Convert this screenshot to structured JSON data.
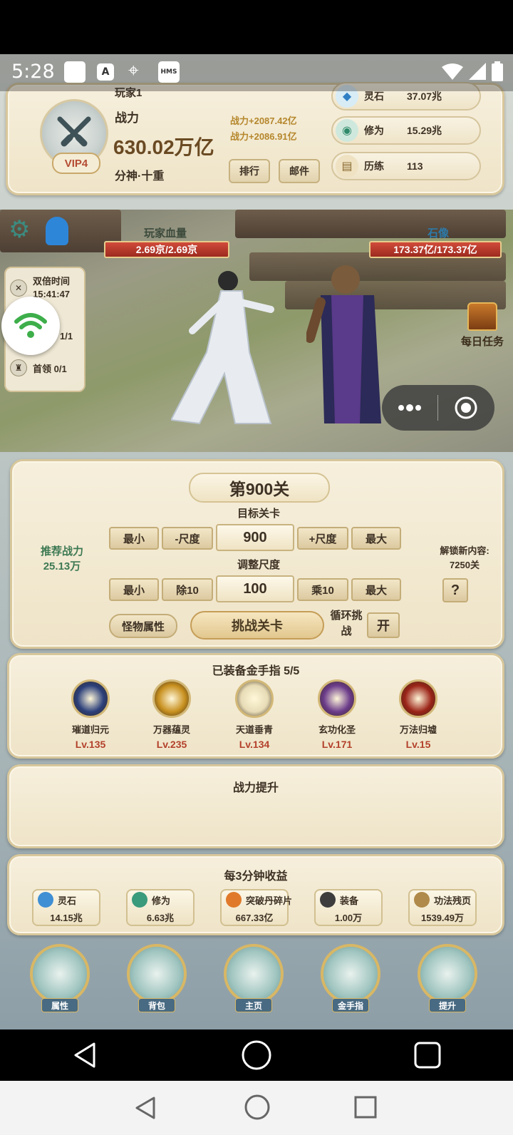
{
  "status_bar": {
    "time": "5:28",
    "hms_label": "HMS",
    "a_label": "A"
  },
  "player": {
    "name": "玩家1",
    "power_label": "战力",
    "power_value": "630.02万亿",
    "vip": "VIP4",
    "realm": "分神·十重",
    "power_gain_1": "战力+2087.42亿",
    "power_gain_2": "战力+2086.91亿",
    "rank_button": "排行",
    "mail_button": "邮件"
  },
  "resources": [
    {
      "name": "灵石",
      "value": "37.07兆",
      "icon": "spirit-stone-icon"
    },
    {
      "name": "修为",
      "value": "15.29兆",
      "icon": "cultivation-icon"
    },
    {
      "name": "历练",
      "value": "113",
      "icon": "scroll-icon"
    }
  ],
  "battle": {
    "player_hp_label": "玩家血量",
    "player_hp": "2.69京/2.69京",
    "enemy_name": "石像",
    "enemy_hp": "173.37亿/173.37亿",
    "double_time_label": "双倍时间",
    "double_time_value": "15:41:47",
    "counter_value": "1/1",
    "boss_label": "首领 0/1",
    "daily_task": "每日任务"
  },
  "stage": {
    "title": "第900关",
    "target_label": "目标关卡",
    "recommend_label": "推荐战力",
    "recommend_value": "25.13万",
    "unlock_label": "解锁新内容:",
    "unlock_value": "7250关",
    "help": "?",
    "row1": {
      "min": "最小",
      "minus": "-尺度",
      "value": "900",
      "plus": "+尺度",
      "max": "最大"
    },
    "scale_label": "调整尺度",
    "row2": {
      "min": "最小",
      "div": "除10",
      "value": "100",
      "mul": "乘10",
      "max": "最大"
    },
    "monster_attr": "怪物属性",
    "challenge": "挑战关卡",
    "loop_label": "循环挑战",
    "loop_toggle": "开"
  },
  "golden_finger": {
    "title": "已装备金手指 5/5",
    "items": [
      {
        "name": "璀道归元",
        "level": "Lv.135",
        "color": "#2b3f7a"
      },
      {
        "name": "万器蕴灵",
        "level": "Lv.235",
        "color": "#c8901f"
      },
      {
        "name": "天道垂青",
        "level": "Lv.134",
        "color": "#e7dcb6"
      },
      {
        "name": "玄功化圣",
        "level": "Lv.171",
        "color": "#6b3b8a"
      },
      {
        "name": "万法归墟",
        "level": "Lv.15",
        "color": "#9b2418"
      }
    ]
  },
  "power_up": {
    "title": "战力提升"
  },
  "income": {
    "title": "每3分钟收益",
    "items": [
      {
        "name": "灵石",
        "value": "14.15兆",
        "color": "#3f8fd4"
      },
      {
        "name": "修为",
        "value": "6.63兆",
        "color": "#3a9a7c"
      },
      {
        "name": "突破丹碎片",
        "value": "667.33亿",
        "color": "#e07a2a"
      },
      {
        "name": "装备",
        "value": "1.00万",
        "color": "#3d3d3d"
      },
      {
        "name": "功法残页",
        "value": "1539.49万",
        "color": "#b08a4a"
      }
    ]
  },
  "nav": [
    {
      "label": "属性"
    },
    {
      "label": "背包"
    },
    {
      "label": "主页"
    },
    {
      "label": "金手指"
    },
    {
      "label": "提升"
    }
  ]
}
